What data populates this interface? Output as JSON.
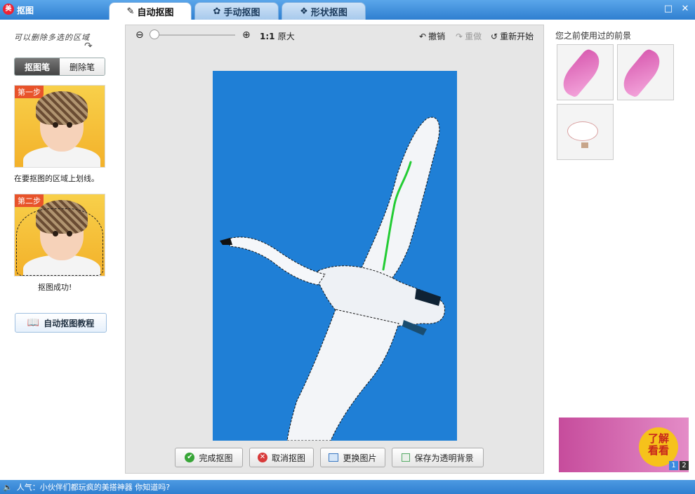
{
  "app": {
    "title": "抠图",
    "logo": "美"
  },
  "tabs": [
    {
      "label": "自动抠图",
      "icon": "brush-icon",
      "active": true
    },
    {
      "label": "手动抠图",
      "icon": "palette-icon",
      "active": false
    },
    {
      "label": "形状抠图",
      "icon": "shapes-icon",
      "active": false
    }
  ],
  "left": {
    "hint": "可以删除多选的区域",
    "pen_active": "抠图笔",
    "pen_inactive": "删除笔",
    "step1_badge": "第一步",
    "step1_caption": "在要抠图的区域上划线。",
    "step2_badge": "第二步",
    "step2_caption": "抠图成功!",
    "tutorial": "自动抠图教程"
  },
  "toolbar": {
    "ratio": "1:1",
    "ratio_label": "原大",
    "undo": "撤销",
    "redo": "重做",
    "restart": "重新开始"
  },
  "actions": {
    "done": "完成抠图",
    "cancel": "取消抠图",
    "replace": "更换图片",
    "save_transparent": "保存为透明背景"
  },
  "right": {
    "title": "您之前使用过的前景",
    "ad_text": "了解\n看看",
    "pages": [
      "1",
      "2"
    ]
  },
  "status": {
    "text": "人气：小伙伴们都玩疯的美搭神器 你知道吗?"
  },
  "colors": {
    "canvas_bg": "#1f7fd6",
    "accent": "#3f8fd8",
    "stroke": "#22cc33"
  }
}
